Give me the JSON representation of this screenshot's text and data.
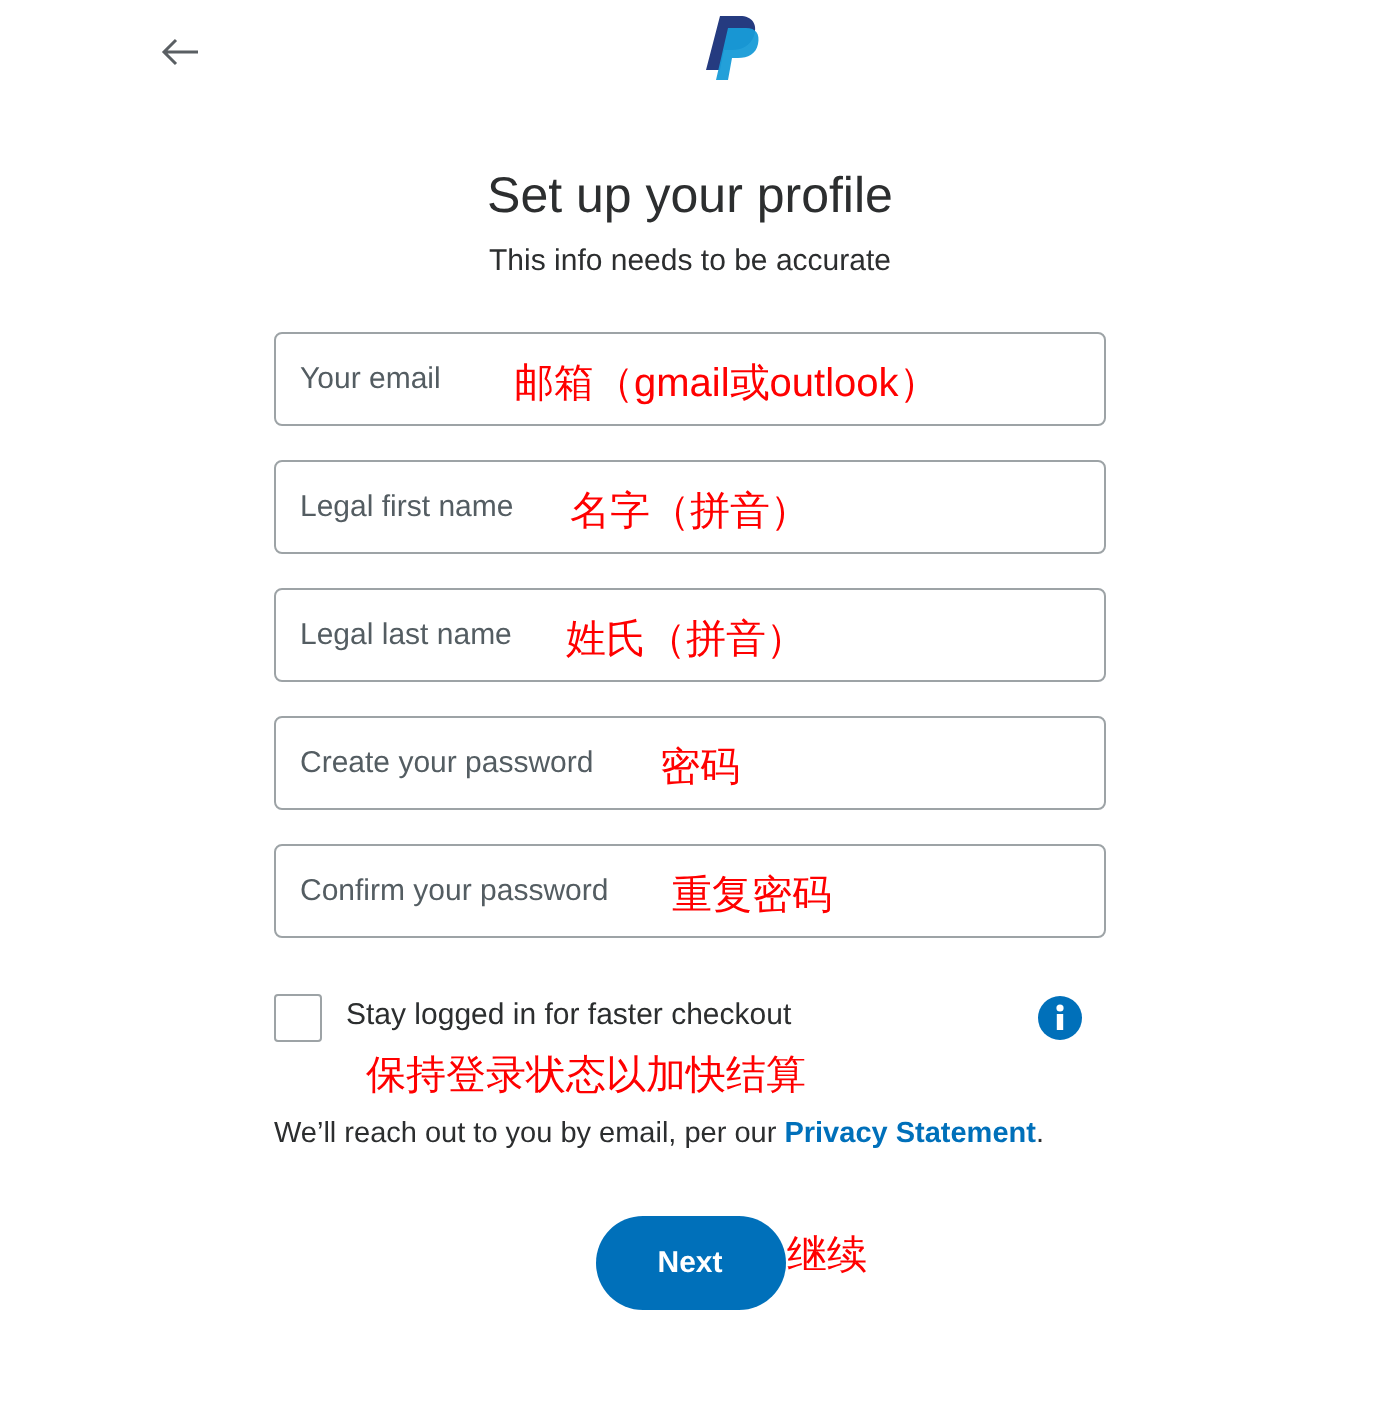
{
  "title": "Set up your profile",
  "subtitle": "This info needs to be accurate",
  "fields": [
    {
      "placeholder": "Your email",
      "annotation": "邮箱（gmail或outlook）"
    },
    {
      "placeholder": "Legal first name",
      "annotation": "名字（拼音）"
    },
    {
      "placeholder": "Legal last name",
      "annotation": "姓氏（拼音）"
    },
    {
      "placeholder": "Create your password",
      "annotation": "密码"
    },
    {
      "placeholder": "Confirm your password",
      "annotation": "重复密码"
    }
  ],
  "stay_logged_in": {
    "label": "Stay logged in for faster checkout",
    "checked": false,
    "annotation": "保持登录状态以加快结算"
  },
  "notice": {
    "text": "We’ll reach out to you by email, per our ",
    "link": "Privacy Statement",
    "end": "."
  },
  "next_button": {
    "label": "Next",
    "annotation": "继续"
  }
}
